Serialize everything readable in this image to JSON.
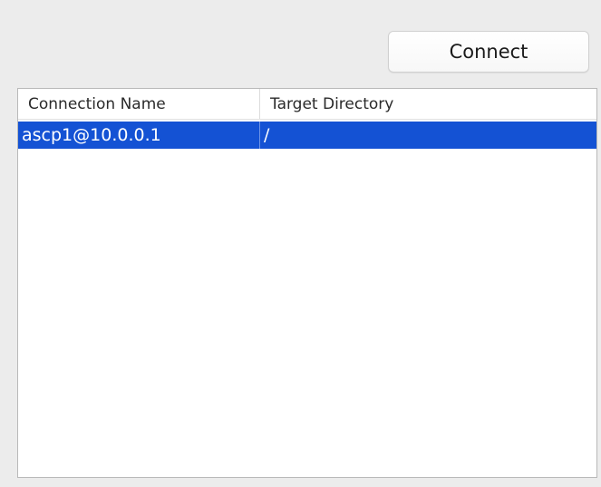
{
  "toolbar": {
    "connect_label": "Connect"
  },
  "table": {
    "columns": [
      "Connection Name",
      "Target Directory"
    ],
    "rows": [
      {
        "connection_name": "ascp1@10.0.0.1",
        "target_directory": "/",
        "selected": true
      }
    ]
  },
  "colors": {
    "window_background": "#ececec",
    "selection": "#1452d4",
    "table_background": "#ffffff"
  }
}
